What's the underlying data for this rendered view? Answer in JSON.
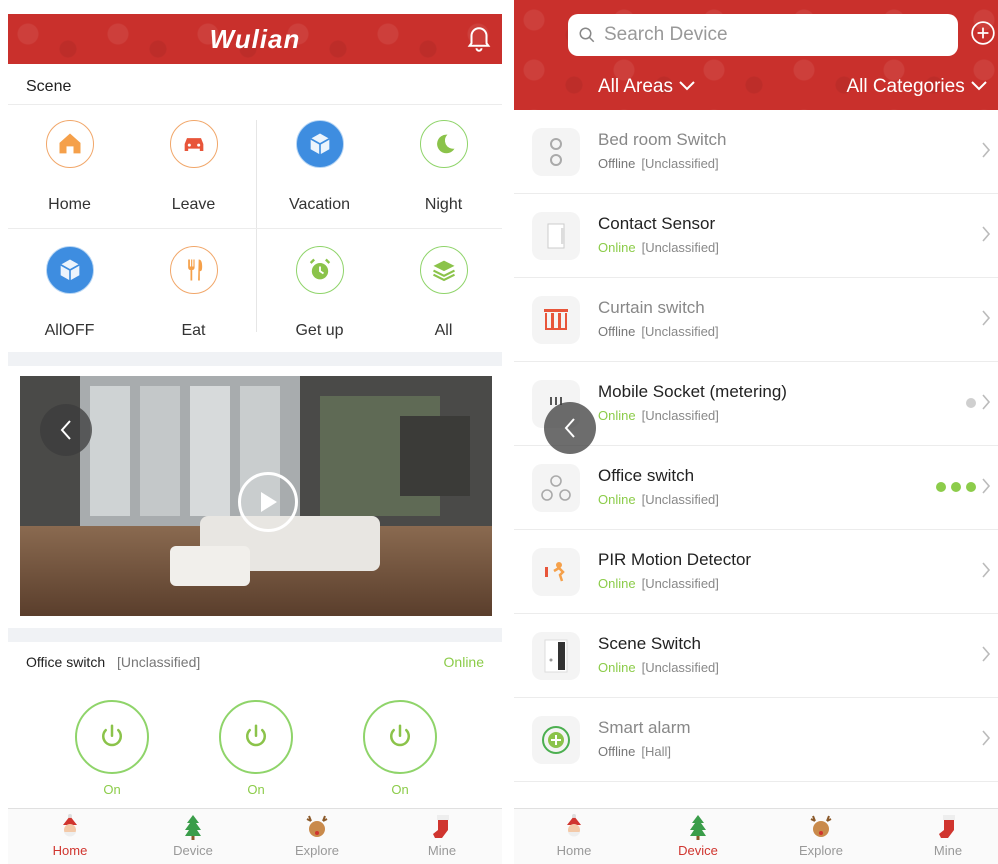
{
  "left_screen": {
    "header": {
      "logo": "Wulian",
      "bell_icon": "bell-icon"
    },
    "scene": {
      "title": "Scene",
      "items": [
        {
          "label": "Home",
          "icon": "home-icon",
          "color": "#f5a04a"
        },
        {
          "label": "Leave",
          "icon": "car-icon",
          "color": "#e8553a"
        },
        {
          "label": "Vacation",
          "icon": "cube-icon",
          "color": "#3e8de0"
        },
        {
          "label": "Night",
          "icon": "moon-icon",
          "color": "#8bc34a"
        },
        {
          "label": "AllOFF",
          "icon": "cube-icon",
          "color": "#3e8de0"
        },
        {
          "label": "Eat",
          "icon": "fork-knife-icon",
          "color": "#f5a04a"
        },
        {
          "label": "Get up",
          "icon": "alarm-clock-icon",
          "color": "#8bc34a"
        },
        {
          "label": "All",
          "icon": "layers-icon",
          "color": "#8bc34a"
        }
      ]
    },
    "camera": {
      "play_icon": "play-icon",
      "prev_icon": "chevron-left-icon"
    },
    "device": {
      "name": "Office switch",
      "category": "[Unclassified]",
      "status": "Online",
      "switches": [
        {
          "label": "On"
        },
        {
          "label": "On"
        },
        {
          "label": "On"
        }
      ]
    },
    "tabbar": [
      {
        "label": "Home",
        "active": true
      },
      {
        "label": "Device",
        "active": false
      },
      {
        "label": "Explore",
        "active": false
      },
      {
        "label": "Mine",
        "active": false
      }
    ]
  },
  "right_screen": {
    "search": {
      "placeholder": "Search Device"
    },
    "filters": {
      "areas": "All Areas",
      "categories": "All Categories"
    },
    "devices": [
      {
        "name": "Bed room Switch",
        "status": "Offline",
        "category": "[Unclassified]",
        "online": false,
        "icon": "double-switch-icon"
      },
      {
        "name": "Contact Sensor",
        "status": "Online",
        "category": "[Unclassified]",
        "online": true,
        "icon": "contact-sensor-icon"
      },
      {
        "name": "Curtain switch",
        "status": "Offline",
        "category": "[Unclassified]",
        "online": false,
        "icon": "curtain-icon"
      },
      {
        "name": "Mobile Socket (metering)",
        "status": "Online",
        "category": "[Unclassified]",
        "online": true,
        "icon": "socket-icon"
      },
      {
        "name": "Office switch",
        "status": "Online",
        "category": "[Unclassified]",
        "online": true,
        "icon": "triple-switch-icon"
      },
      {
        "name": "PIR Motion Detector",
        "status": "Online",
        "category": "[Unclassified]",
        "online": true,
        "icon": "motion-detector-icon"
      },
      {
        "name": "Scene Switch",
        "status": "Online",
        "category": "[Unclassified]",
        "online": true,
        "icon": "scene-switch-icon"
      },
      {
        "name": "Smart alarm",
        "status": "Offline",
        "category": "[Hall]",
        "online": false,
        "icon": "alarm-icon"
      }
    ],
    "tabbar": [
      {
        "label": "Home",
        "active": false
      },
      {
        "label": "Device",
        "active": true
      },
      {
        "label": "Explore",
        "active": false
      },
      {
        "label": "Mine",
        "active": false
      }
    ]
  },
  "colors": {
    "brand_red": "#c9302c",
    "online_green": "#8ccc4a",
    "active_tab": "#d0352f"
  }
}
